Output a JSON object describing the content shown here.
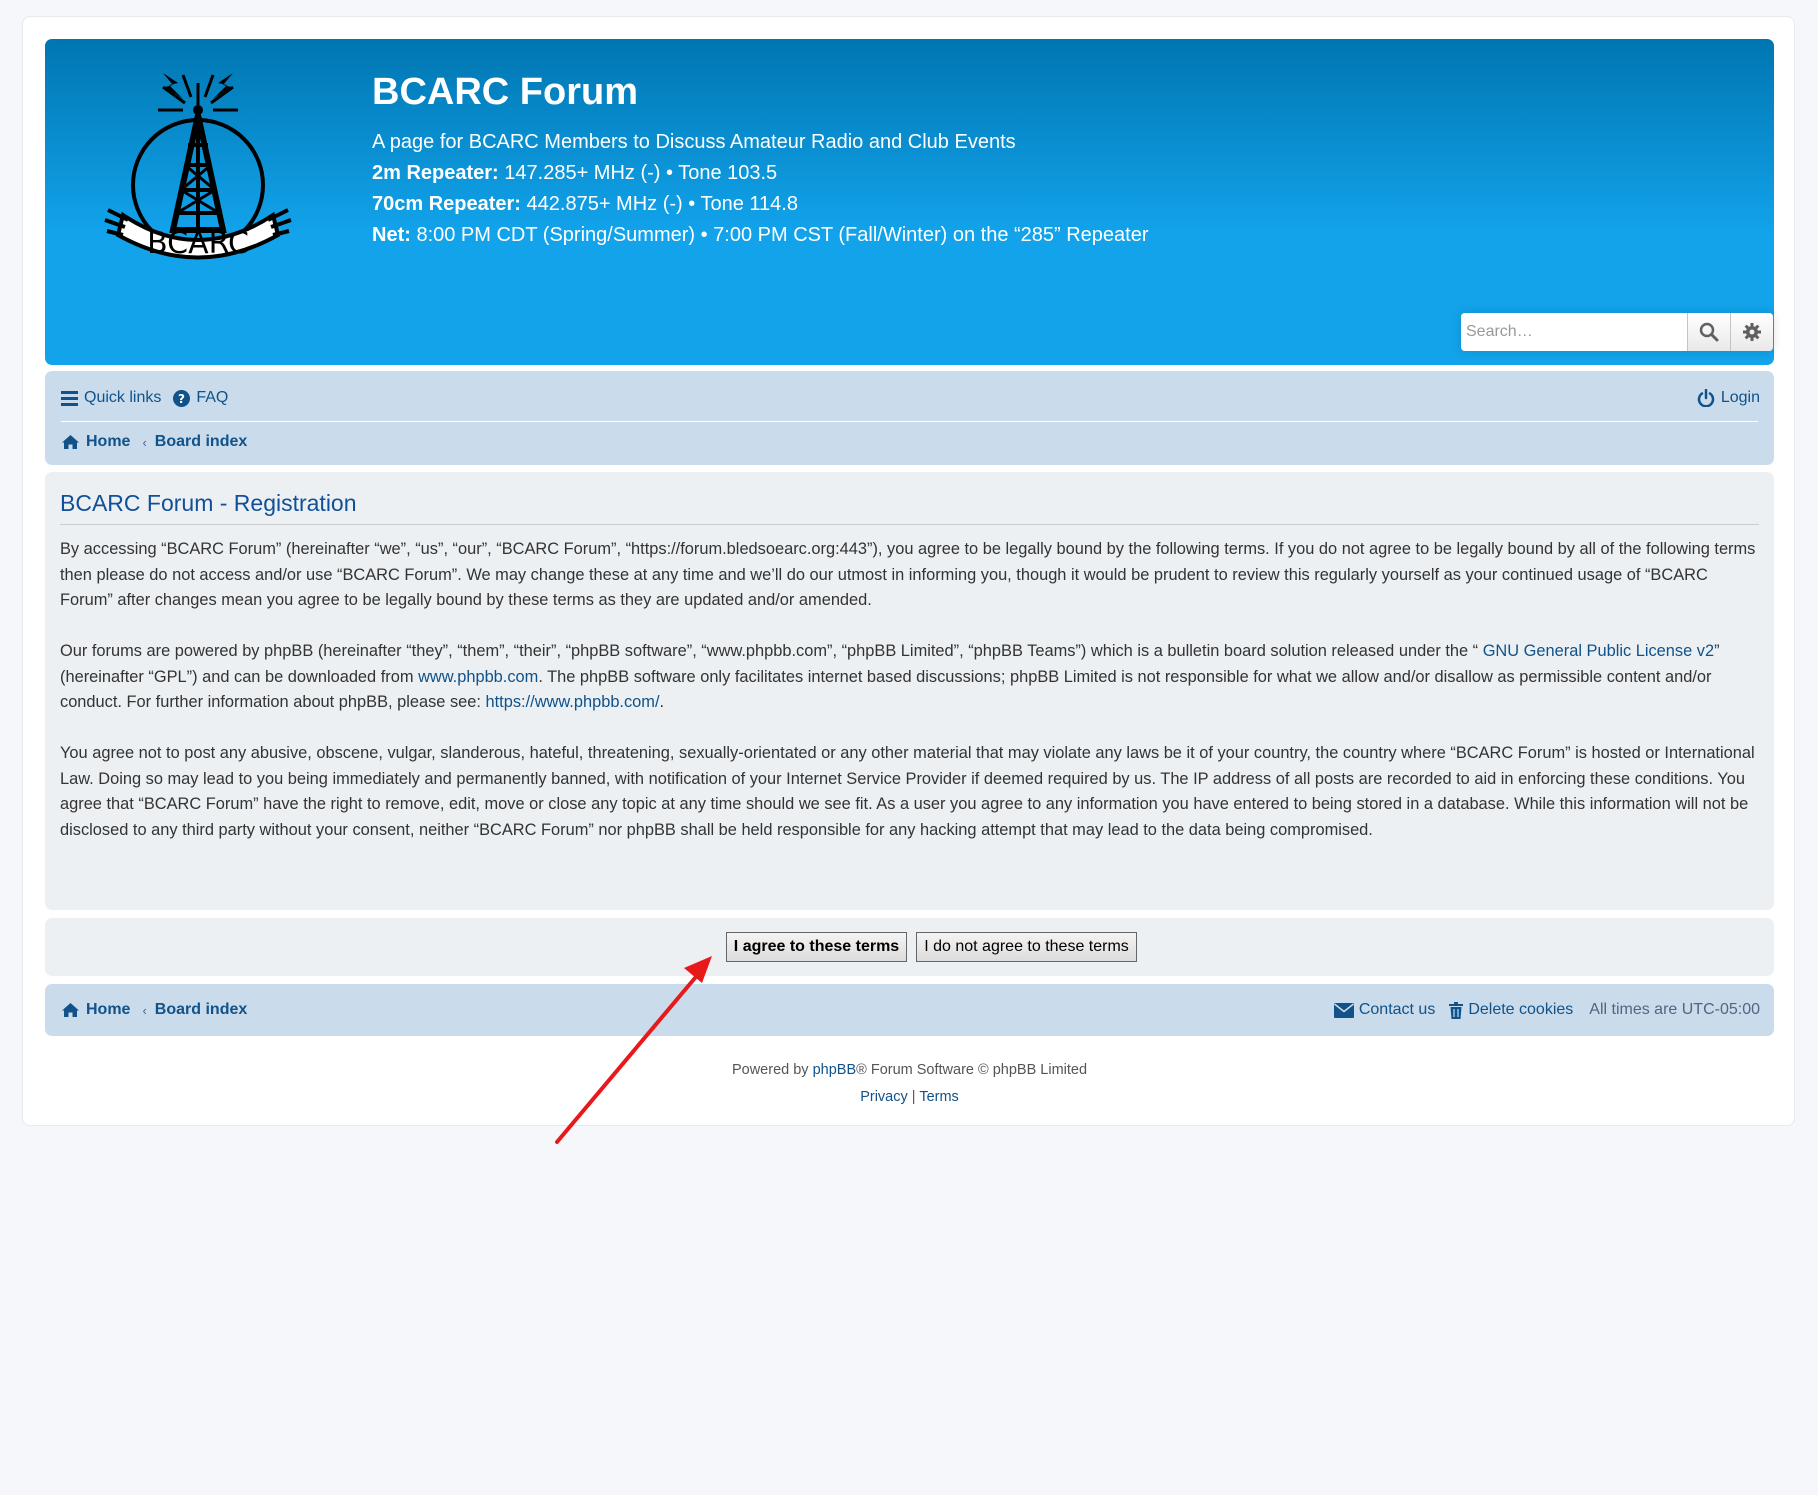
{
  "header": {
    "title": "BCARC Forum",
    "description": "A page for BCARC Members to Discuss Amateur Radio and Club Events",
    "line2_label": "2m Repeater:",
    "line2_value": " 147.285+ MHz (-) • Tone 103.5",
    "line3_label": "70cm Repeater:",
    "line3_value": " 442.875+ MHz (-) • Tone 114.8",
    "line4_label": "Net:",
    "line4_value": " 8:00 PM CDT (Spring/Summer) • 7:00 PM CST (Fall/Winter) on the “285” Repeater",
    "logo_text": "BCARC"
  },
  "search": {
    "placeholder": "Search…"
  },
  "nav": {
    "quick_links": "Quick links",
    "faq": "FAQ",
    "login": "Login",
    "home": "Home",
    "board_index": "Board index",
    "crumb_sep": "‹"
  },
  "registration": {
    "title": "BCARC Forum - Registration",
    "p1": "By accessing “BCARC Forum” (hereinafter “we”, “us”, “our”, “BCARC Forum”, “https://forum.bledsoearc.org:443”), you agree to be legally bound by the following terms. If you do not agree to be legally bound by all of the following terms then please do not access and/or use “BCARC Forum”. We may change these at any time and we’ll do our utmost in informing you, though it would be prudent to review this regularly yourself as your continued usage of “BCARC Forum” after changes mean you agree to be legally bound by these terms as they are updated and/or amended.",
    "p2_a": "Our forums are powered by phpBB (hereinafter “they”, “them”, “their”, “phpBB software”, “www.phpbb.com”, “phpBB Limited”, “phpBB Teams”) which is a bulletin board solution released under the “ ",
    "p2_link1": "GNU General Public License v2",
    "p2_b": "” (hereinafter “GPL”) and can be downloaded from ",
    "p2_link2": "www.phpbb.com",
    "p2_c": ". The phpBB software only facilitates internet based discussions; phpBB Limited is not responsible for what we allow and/or disallow as permissible content and/or conduct. For further information about phpBB, please see: ",
    "p2_link3": "https://www.phpbb.com/",
    "p2_d": ".",
    "p3": "You agree not to post any abusive, obscene, vulgar, slanderous, hateful, threatening, sexually-orientated or any other material that may violate any laws be it of your country, the country where “BCARC Forum” is hosted or International Law. Doing so may lead to you being immediately and permanently banned, with notification of your Internet Service Provider if deemed required by us. The IP address of all posts are recorded to aid in enforcing these conditions. You agree that “BCARC Forum” have the right to remove, edit, move or close any topic at any time should we see fit. As a user you agree to any information you have entered to being stored in a database. While this information will not be disclosed to any third party without your consent, neither “BCARC Forum” nor phpBB shall be held responsible for any hacking attempt that may lead to the data being compromised."
  },
  "buttons": {
    "agree": "I agree to these terms",
    "disagree": "I do not agree to these terms"
  },
  "footer_nav": {
    "home": "Home",
    "board_index": "Board index",
    "crumb_sep": "‹",
    "contact": "Contact us",
    "delete_cookies": "Delete cookies",
    "timezone": "All times are UTC-05:00"
  },
  "copyright": {
    "powered_by": "Powered by ",
    "phpbb": "phpBB",
    "rest": "® Forum Software © phpBB Limited",
    "privacy": "Privacy",
    "sep": " | ",
    "terms": "Terms"
  },
  "colors": {
    "header_top": "#0076b1",
    "header_bottom": "#12a3eb",
    "navbar": "#cadceb",
    "panel": "#ecf0f3",
    "link": "#105289",
    "annotation_arrow": "#e8191b"
  }
}
